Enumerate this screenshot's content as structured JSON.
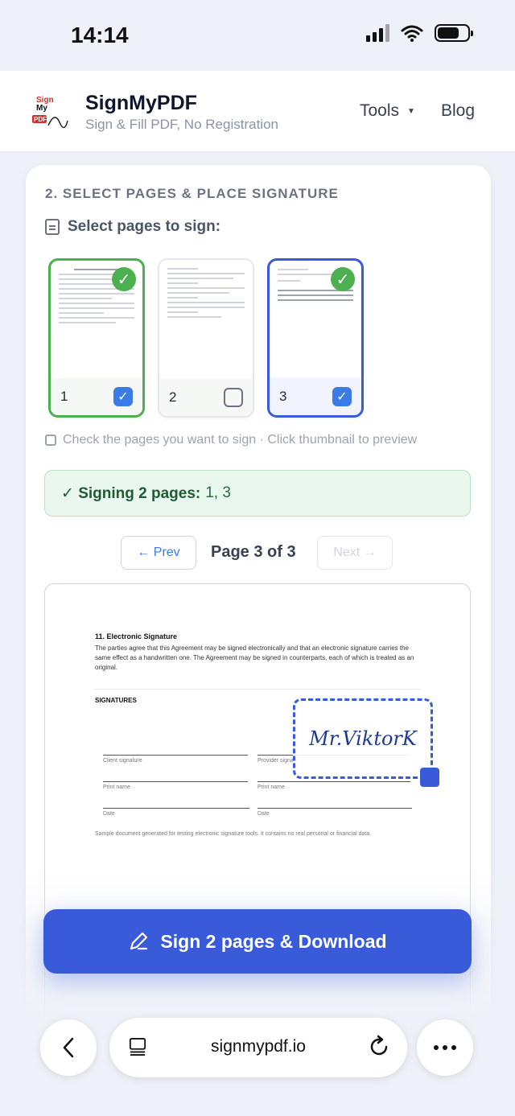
{
  "status": {
    "time": "14:14"
  },
  "header": {
    "logo_text_top": "Sign",
    "logo_text_mid": "My",
    "logo_text_pdf": "PDF",
    "brand": "SignMyPDF",
    "tagline": "Sign & Fill PDF, No Registration",
    "nav": {
      "tools": "Tools",
      "blog": "Blog"
    }
  },
  "step": {
    "title": "2. SELECT PAGES & PLACE SIGNATURE",
    "select_label": "Select pages to sign:",
    "thumbnails": [
      {
        "number": "1",
        "selected": true
      },
      {
        "number": "2",
        "selected": false
      },
      {
        "number": "3",
        "selected": true
      }
    ],
    "hint": "Check the pages you want to sign · Click thumbnail to preview",
    "signing_label": "✓ Signing 2 pages:",
    "signing_pages": "1, 3"
  },
  "pager": {
    "prev": "← Prev",
    "indicator": "Page 3 of 3",
    "next": "Next →"
  },
  "preview_doc": {
    "heading": "11. Electronic Signature",
    "paragraph": "The parties agree that this Agreement may be signed electronically and that an electronic signature carries the same effect as a handwritten one. The Agreement may be signed in counterparts, each of which is treated as an original.",
    "signatures_title": "SIGNATURES",
    "client_signature": "Client signature",
    "provider_signature": "Provider signa",
    "print_name_1": "Print name",
    "print_name_2": "Print name",
    "date_1": "Date",
    "date_2": "Date",
    "footer": "Sample document generated for testing electronic signature tools. It contains no real personal or financial data."
  },
  "signature": {
    "text": "Mr.ViktorK"
  },
  "cta": {
    "label": "Sign 2 pages & Download"
  },
  "browser": {
    "url": "signmypdf.io"
  },
  "colors": {
    "accent": "#3a5bd9",
    "success": "#4caf50",
    "success_bg": "#e9f7ee"
  }
}
